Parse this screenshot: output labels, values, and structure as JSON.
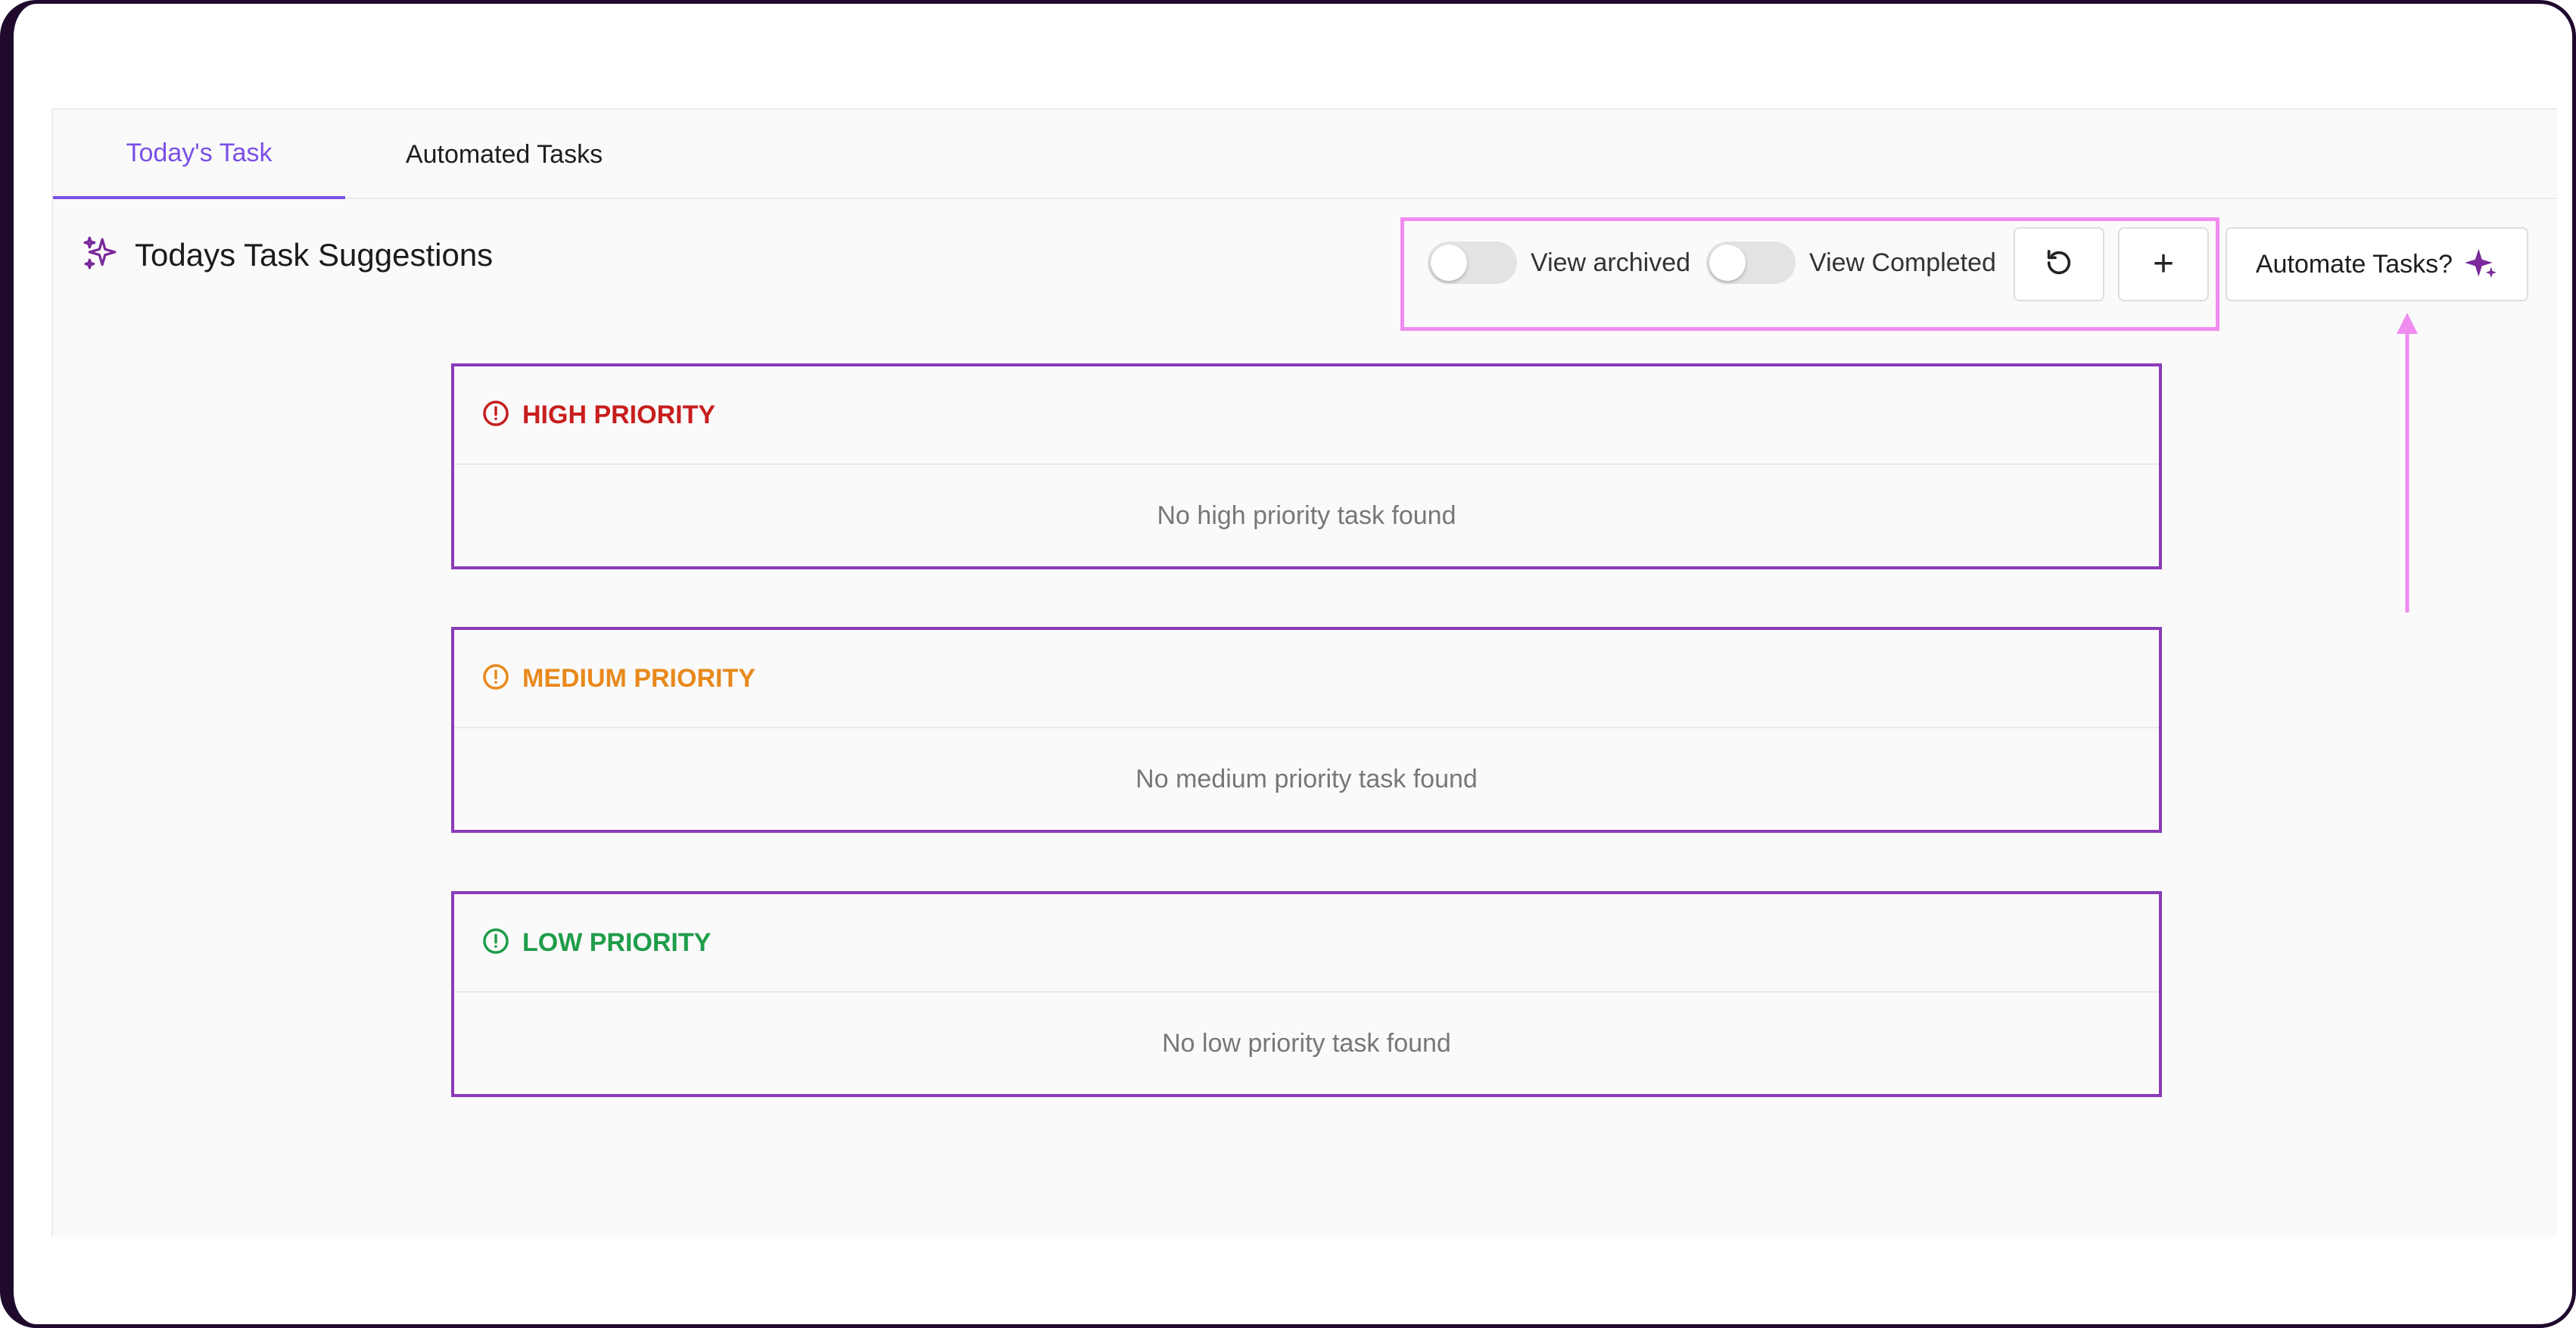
{
  "tabs": [
    {
      "label": "Today's Task",
      "active": true
    },
    {
      "label": "Automated Tasks",
      "active": false
    }
  ],
  "heading": {
    "title": "Todays Task Suggestions",
    "icon": "sparkles-icon"
  },
  "toolbar": {
    "view_archived_label": "View archived",
    "view_archived_on": false,
    "view_completed_label": "View Completed",
    "view_completed_on": false,
    "refresh_icon": "refresh-icon",
    "add_label": "+",
    "automate_label": "Automate Tasks?",
    "automate_icon": "sparkle-icon"
  },
  "priorities": [
    {
      "title": "HIGH PRIORITY",
      "empty_text": "No high priority task found",
      "color": "#c81e1e"
    },
    {
      "title": "MEDIUM PRIORITY",
      "empty_text": "No medium priority task found",
      "color": "#e8891c"
    },
    {
      "title": "LOW PRIORITY",
      "empty_text": "No low priority task found",
      "color": "#1f9d4a"
    }
  ],
  "colors": {
    "accent": "#7b4fe6",
    "card_border": "#8a3bb8",
    "annotation": "#f08cf0",
    "sparkle": "#7a2a9a"
  }
}
